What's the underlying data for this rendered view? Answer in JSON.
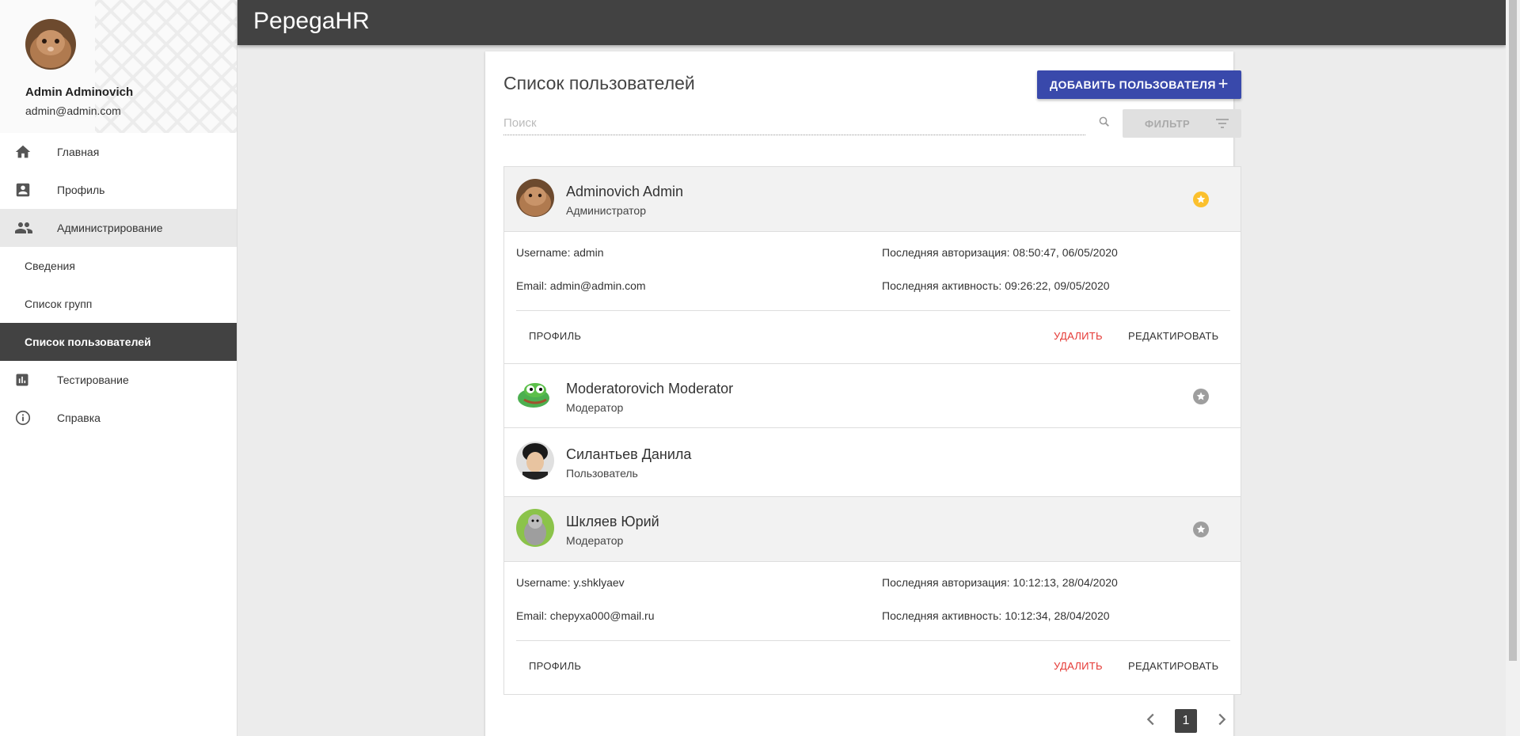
{
  "app": {
    "title": "PepegaHR"
  },
  "profile": {
    "name": "Admin Adminovich",
    "email": "admin@admin.com"
  },
  "nav": {
    "home": "Главная",
    "profile": "Профиль",
    "admin": "Администрирование",
    "admin_sub": [
      "Сведения",
      "Список групп",
      "Список пользователей"
    ],
    "testing": "Тестирование",
    "help": "Справка"
  },
  "page": {
    "title": "Список пользователей",
    "add_button": "ДОБАВИТЬ ПОЛЬЗОВАТЕЛЯ",
    "search_placeholder": "Поиск",
    "filter_button": "ФИЛЬТР"
  },
  "users": [
    {
      "name": "Adminovich Admin",
      "role": "Администратор",
      "star_color": "#fbc02d",
      "username": "Username: admin",
      "email": "Email: admin@admin.com",
      "last_auth": "Последняя авторизация: 08:50:47, 06/05/2020",
      "last_active": "Последняя активность: 09:26:22, 09/05/2020"
    },
    {
      "name": "Moderatorovich Moderator",
      "role": "Модератор",
      "star_color": "#9e9e9e"
    },
    {
      "name": "Силантьев Данила",
      "role": "Пользователь"
    },
    {
      "name": "Шкляев Юрий",
      "role": "Модератор",
      "star_color": "#9e9e9e",
      "username": "Username: y.shklyaev",
      "email": "Email: chepyxa000@mail.ru",
      "last_auth": "Последняя авторизация: 10:12:13, 28/04/2020",
      "last_active": "Последняя активность: 10:12:34, 28/04/2020"
    }
  ],
  "actions": {
    "profile": "ПРОФИЛЬ",
    "delete": "УДАЛИТЬ",
    "edit": "РЕДАКТИРОВАТЬ"
  },
  "pagination": {
    "current": "1"
  }
}
